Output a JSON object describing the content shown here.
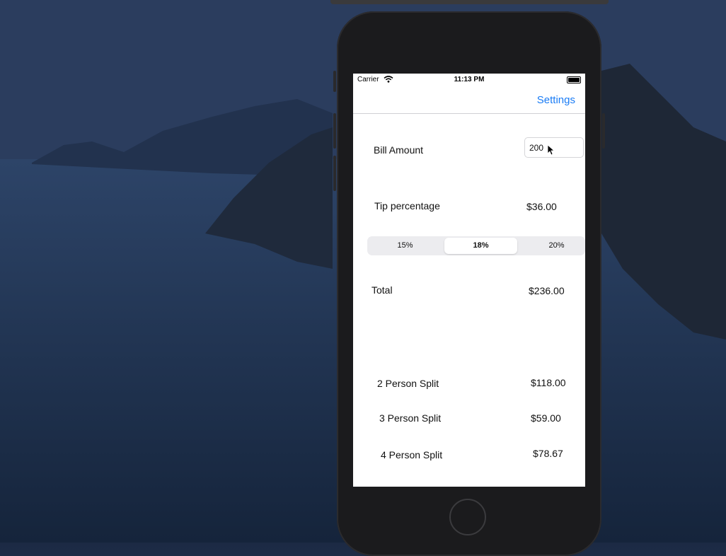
{
  "status_bar": {
    "carrier": "Carrier",
    "time": "11:13 PM"
  },
  "nav": {
    "settings_label": "Settings"
  },
  "bill": {
    "label": "Bill Amount",
    "value": "200"
  },
  "tip": {
    "label": "Tip percentage",
    "amount": "$36.00"
  },
  "segments": [
    {
      "label": "15%",
      "selected": false
    },
    {
      "label": "18%",
      "selected": true
    },
    {
      "label": "20%",
      "selected": false
    }
  ],
  "total": {
    "label": "Total",
    "amount": "$236.00"
  },
  "splits": [
    {
      "label": "2 Person Split",
      "amount": "$118.00"
    },
    {
      "label": "3 Person Split",
      "amount": "$59.00"
    },
    {
      "label": "4 Person Split",
      "amount": "$78.67"
    }
  ],
  "colors": {
    "accent": "#1a7cf5",
    "phone_body": "#1b1b1d",
    "background": "#253a5a"
  }
}
